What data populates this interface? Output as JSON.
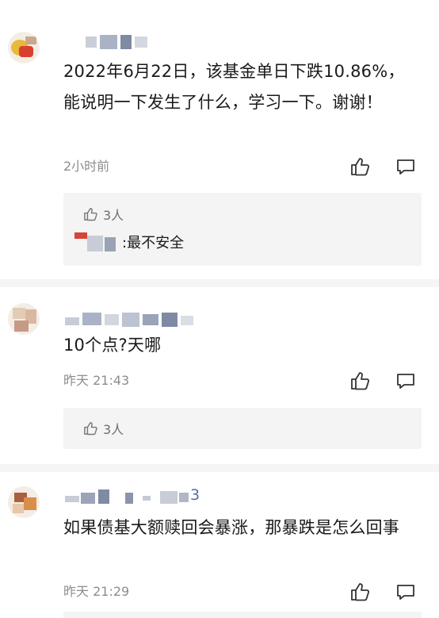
{
  "comments": [
    {
      "text": "2022年6月22日，该基金单日下跌10.86%，能说明一下发生了什么，学习一下。谢谢！",
      "time": "2小时前",
      "sub": {
        "likes": "3人",
        "reply_text": ":最不安全"
      }
    },
    {
      "text": "10个点?天哪",
      "time": "昨天 21:43",
      "sub": {
        "likes": "3人"
      }
    },
    {
      "username_tail": "3",
      "text": "如果债基大额赎回会暴涨，那暴跌是怎么回事",
      "time": "昨天 21:29"
    }
  ],
  "icons": {
    "like": "thumbs-up-icon",
    "comment": "comment-icon"
  },
  "colors": {
    "text": "#1a1a1a",
    "meta": "#8d8d8d",
    "sub_background": "#f4f4f4",
    "username_accent": "#5b6fa3"
  }
}
